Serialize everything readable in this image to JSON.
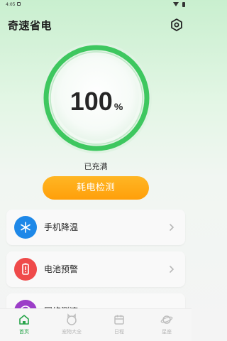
{
  "status_bar": {
    "time": "4:05"
  },
  "header": {
    "title": "奇速省电"
  },
  "battery": {
    "level_percent": 100,
    "value": "100",
    "unit": "%",
    "status": "已充满"
  },
  "action_button": {
    "label": "耗电检测"
  },
  "menu": [
    {
      "label": "手机降温",
      "icon": "snowflake-icon",
      "color": "#1e88e8"
    },
    {
      "label": "电池预警",
      "icon": "battery-alert-icon",
      "color": "#ef4a4a"
    },
    {
      "label": "网络测速",
      "icon": "speed-icon",
      "color": "#9c3ec8"
    }
  ],
  "tabs": [
    {
      "label": "首页",
      "icon": "home-icon",
      "active": true
    },
    {
      "label": "宠物大全",
      "icon": "pet-icon",
      "active": false
    },
    {
      "label": "日程",
      "icon": "calendar-icon",
      "active": false
    },
    {
      "label": "星座",
      "icon": "planet-icon",
      "active": false
    }
  ],
  "colors": {
    "accent": "#2fbf54",
    "ring": "#3ec75f",
    "button": "#ffa614",
    "tab_active": "#27a44a"
  }
}
